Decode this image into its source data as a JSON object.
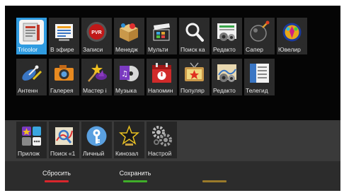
{
  "apps_row1": [
    {
      "label": "Tricolor",
      "icon": "tricolor-icon"
    },
    {
      "label": "В эфире",
      "icon": "broadcast-icon"
    },
    {
      "label": "Записи",
      "icon": "pvr-icon"
    },
    {
      "label": "Менедж",
      "icon": "box-icon"
    },
    {
      "label": "Мульти",
      "icon": "clapper-icon"
    },
    {
      "label": "Поиск ка",
      "icon": "search-icon"
    },
    {
      "label": "Редакто",
      "icon": "editor-gears-icon"
    },
    {
      "label": "Сапер",
      "icon": "mine-icon"
    },
    {
      "label": "Ювелир",
      "icon": "jewel-icon"
    }
  ],
  "apps_row2": [
    {
      "label": "Антенн",
      "icon": "antenna-icon"
    },
    {
      "label": "Галерея",
      "icon": "camera-icon"
    },
    {
      "label": "Мастер і",
      "icon": "wizard-hat-icon"
    },
    {
      "label": "Музыка",
      "icon": "music-icon"
    },
    {
      "label": "Напомин",
      "icon": "reminder-calendar-icon"
    },
    {
      "label": "Популяр",
      "icon": "tv-star-icon"
    },
    {
      "label": "Редакто",
      "icon": "editor-map-icon"
    },
    {
      "label": "Телегид",
      "icon": "tv-guide-icon"
    }
  ],
  "favorites": [
    {
      "label": "Прилож",
      "icon": "apps-grid-icon"
    },
    {
      "label": "Поиск «1",
      "icon": "search-map-icon"
    },
    {
      "label": "Личный",
      "icon": "key-icon"
    },
    {
      "label": "Кинозал",
      "icon": "cinema-star-icon"
    },
    {
      "label": "Настрой",
      "icon": "settings-gears-icon"
    }
  ],
  "actions": {
    "reset_label": "Сбросить",
    "save_label": "Сохранить",
    "third_label": ""
  },
  "colors": {
    "selection": "#2f9be0",
    "reset_bar": "#d9262c",
    "save_bar": "#3fae29",
    "third_bar": "#9a7a2a"
  }
}
